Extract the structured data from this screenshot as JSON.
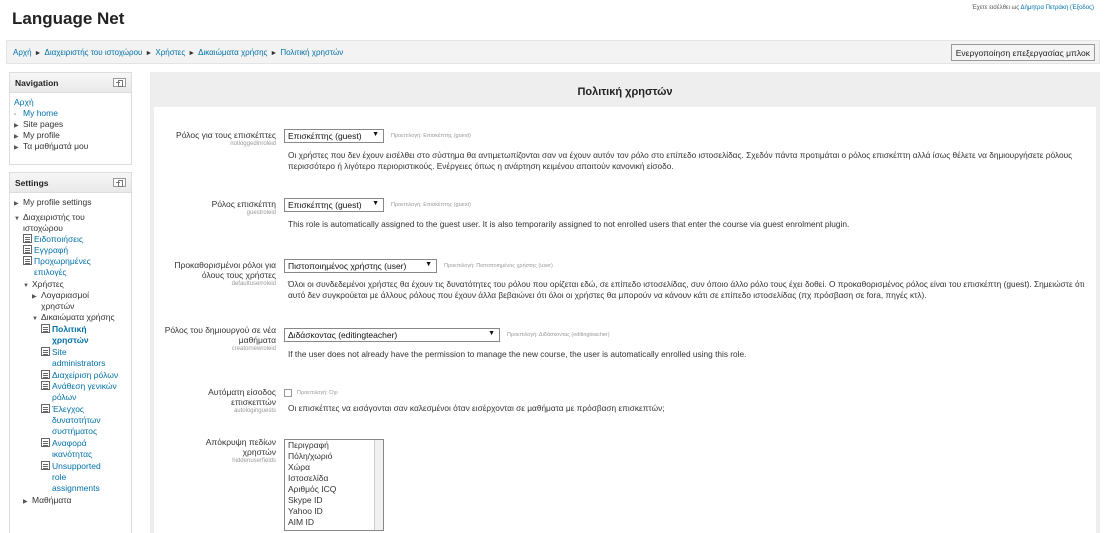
{
  "site": {
    "title": "Language Net"
  },
  "login": {
    "prefix": "Έχετε εισέλθει ως",
    "user": "Δήμητρα Πετράκη",
    "logout": "(Έξοδος)"
  },
  "breadcrumb": [
    "Αρχή",
    "Διαχειριστής του ιστοχώρου",
    "Χρήστες",
    "Δικαιώματα χρήσης",
    "Πολιτική χρηστών"
  ],
  "breadcrumb_sep": "►",
  "buttons": {
    "blocks_editing": "Ενεργοποίηση επεξεργασίας μπλοκ"
  },
  "navigation": {
    "title": "Navigation",
    "items": [
      "Αρχή",
      "My home",
      "Site pages",
      "My profile",
      "Τα μαθήματά μου"
    ]
  },
  "settings": {
    "title": "Settings",
    "items": {
      "my_profile": "My profile settings",
      "site_admin": [
        "Διαχειριστής του",
        "ιστοχώρου"
      ],
      "notifications": "Ειδοποιήσεις",
      "registration": "Εγγραφή",
      "advanced": [
        "Προχωρημένες",
        "επιλογές"
      ],
      "users": "Χρήστες",
      "accounts": [
        "Λογαριασμοί",
        "χρηστών"
      ],
      "permissions": "Δικαιώματα χρήσης",
      "user_policies": [
        "Πολιτική",
        "χρηστών"
      ],
      "site_administrators": [
        "Site",
        "administrators"
      ],
      "define_roles": "Διαχείριση ρόλων",
      "assign_roles": [
        "Ανάθεση γενικών",
        "ρόλων"
      ],
      "check_permissions": [
        "Έλεγχος",
        "δυνατοτήτων",
        "συστήματος"
      ],
      "capability_report": [
        "Αναφορά",
        "ικανότητας"
      ],
      "unsupported": [
        "Unsupported",
        "role",
        "assignments"
      ],
      "courses": "Μαθήματα"
    }
  },
  "page": {
    "heading": "Πολιτική χρηστών"
  },
  "form": [
    {
      "label": "Ρόλος για τους επισκέπτες",
      "key": "notloggedinroleid",
      "value": "Επισκέπτης (guest)",
      "default": "Προεπιλογή: Επισκέπτης (guest)",
      "desc": "Οι χρήστες που δεν έχουν εισέλθει στο σύστημα θα αντιμετωπίζονται σαν να έχουν αυτόν τον ρόλο στο επίπεδο ιστοσελίδας. Σχεδόν πάντα προτιμάται ο ρόλος επισκέπτη αλλά ίσως θέλετε να δημιουργήσετε ρόλους περισσότερο ή λιγότερο περιοριστικούς. Ενέργειες όπως η ανάρτηση κειμένου απαιτούν κανονική είσοδο."
    },
    {
      "label": "Ρόλος επισκέπτη",
      "key": "guestroleid",
      "value": "Επισκέπτης (guest)",
      "default": "Προεπιλογή: Επισκέπτης (guest)",
      "desc": "This role is automatically assigned to the guest user. It is also temporarily assigned to not enrolled users that enter the course via guest enrolment plugin."
    },
    {
      "label": "Προκαθορισμένοι ρόλοι για όλους τους χρήστες",
      "key": "defaultuserroleid",
      "value": "Πιστοποιημένος χρήστης (user)",
      "default": "Προεπιλογή: Πιστοποιημένος χρήστης (user)",
      "desc": "Όλοι οι συνδεδεμένοι χρήστες θα έχουν τις δυνατότητες του ρόλου που ορίζεται εδώ, σε επίπεδο ιστοσελίδας, συν όποιο άλλο ρόλο τους έχει δοθεί. Ο προκαθορισμένος ρόλος είναι του επισκέπτη (guest). Σημειώστε ότι αυτό δεν συγκρούεται με άλλους ρόλους που έχουν άλλα βεβαιώνει ότι όλοι οι χρήστες θα μπορούν να κάνουν κάτι σε επίπεδο ιστοσελίδας (πχ πρόσβαση σε fora, πηγές κτλ)."
    },
    {
      "label": "Ρόλος του δημιουργού σε νέα μαθήματα",
      "key": "creatornewroleid",
      "value": "Διδάσκοντας (editingteacher)",
      "default": "Προεπιλογή: Διδάσκοντας (editingteacher)",
      "desc": "If the user does not already have the permission to manage the new course, the user is automatically enrolled using this role."
    },
    {
      "label": "Αυτόματη είσοδος επισκεπτών",
      "key": "autologinguests",
      "default": "Προεπιλογή: Όχι",
      "desc": "Οι επισκέπτες να εισάγονται σαν καλεσμένοι όταν εισέρχονται σε μαθήματα με πρόσβαση επισκεπτών;"
    },
    {
      "label": "Απόκρυψη πεδίων χρηστών",
      "key": "hiddenuserfields",
      "options": [
        "Περιγραφή",
        "Πόλη/χωριό",
        "Χώρα",
        "Ιστοσελίδα",
        "Αριθμός ICQ",
        "Skype ID",
        "Yahoo ID",
        "AIM ID"
      ]
    }
  ]
}
